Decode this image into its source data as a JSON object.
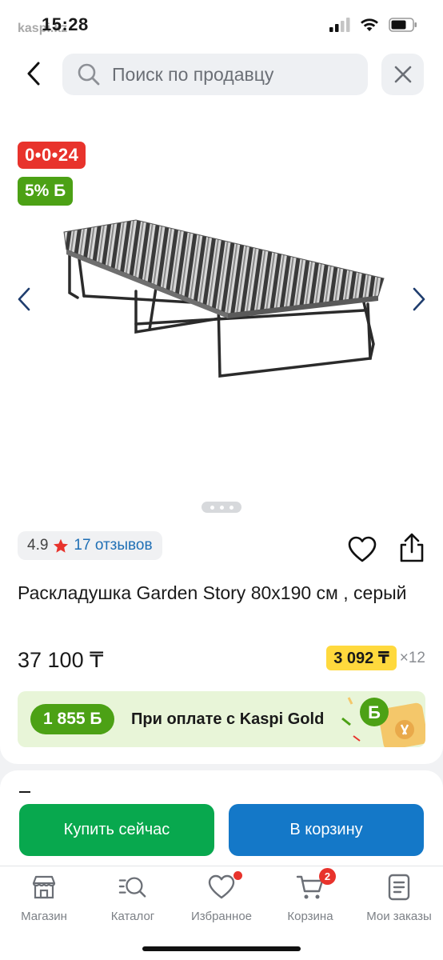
{
  "status_bar": {
    "time": "15:28",
    "watermark": "kaspi.kz",
    "icons": [
      "signal-icon",
      "wifi-icon",
      "battery-icon"
    ]
  },
  "search": {
    "placeholder": "Поиск по продавцу",
    "icon": "search-icon"
  },
  "product": {
    "timer": "0•0•24",
    "bonus_badge": "5% Б",
    "rating": "4.9",
    "reviews": "17 отзывов",
    "title": "Раскладушка Garden Story 80x190 см , серый",
    "price": "37 100 ₸",
    "installment_amount": "3 092 ₸",
    "installment_months": "×12",
    "gallery_page": 2,
    "gallery_total": 3
  },
  "kaspi_gold": {
    "amount": "1 855 Б",
    "text": "При оплате с Kaspi Gold"
  },
  "actions": {
    "buy_now": "Купить сейчас",
    "add_to_cart": "В корзину"
  },
  "tabs": [
    {
      "label": "Магазин",
      "icon": "store-icon"
    },
    {
      "label": "Каталог",
      "icon": "catalog-search-icon"
    },
    {
      "label": "Избранное",
      "icon": "heart-icon"
    },
    {
      "label": "Корзина",
      "icon": "cart-icon"
    },
    {
      "label": "Мои заказы",
      "icon": "orders-icon"
    }
  ],
  "cart_badge": "2",
  "colors": {
    "timer_red": "#e8332c",
    "bonus_green": "#4ca115",
    "buy_green": "#08a84e",
    "cart_blue": "#1478c8",
    "installment_yellow": "#ffd93d",
    "link_blue": "#1f6fb5"
  }
}
